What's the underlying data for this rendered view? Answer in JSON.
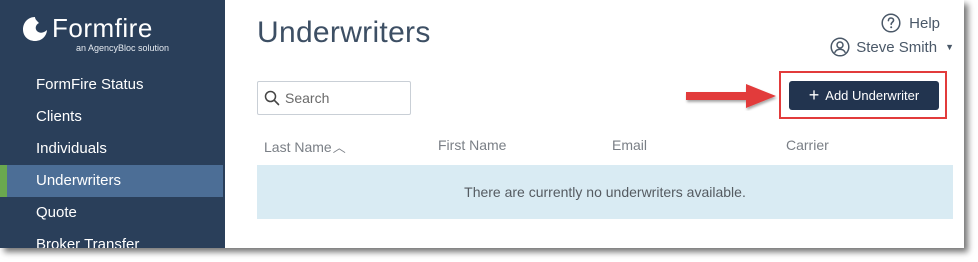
{
  "brand": {
    "name": "Formfire",
    "tagline": "an AgencyBloc solution"
  },
  "sidebar": {
    "items": [
      {
        "label": "FormFire Status",
        "active": false
      },
      {
        "label": "Clients",
        "active": false
      },
      {
        "label": "Individuals",
        "active": false
      },
      {
        "label": "Underwriters",
        "active": true
      },
      {
        "label": "Quote",
        "active": false
      },
      {
        "label": "Broker Transfer",
        "active": false
      }
    ]
  },
  "header": {
    "title": "Underwriters",
    "help_label": "Help",
    "help_icon": "question-circle-icon",
    "user_name": "Steve Smith",
    "user_icon": "user-circle-icon"
  },
  "toolbar": {
    "search_placeholder": "Search",
    "add_label": "Add Underwriter"
  },
  "table": {
    "columns": [
      "Last Name",
      "First Name",
      "Email",
      "Carrier"
    ],
    "sorted_column": "Last Name",
    "sort_direction": "ascending",
    "empty_message": "There are currently no underwriters available."
  },
  "colors": {
    "sidebar_bg": "#2a3f5a",
    "active_item_bg": "#4c6e96",
    "active_indicator": "#6aa84f",
    "primary_button": "#22344f",
    "annotation_red": "#e23b3b",
    "empty_row_bg": "#d9ebf3"
  }
}
